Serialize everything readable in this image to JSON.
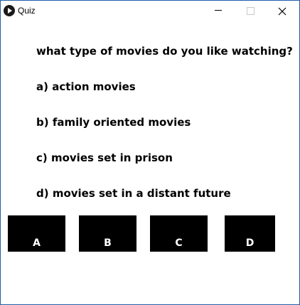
{
  "window": {
    "title": "Quiz",
    "app_icon": "play-circle-icon",
    "controls": {
      "minimize_icon": "minimize-icon",
      "maximize_icon": "maximize-icon",
      "close_icon": "close-icon"
    }
  },
  "quiz": {
    "question": "what type of movies do you like watching?",
    "options": [
      {
        "text": "a) action movies"
      },
      {
        "text": "b) family oriented movies"
      },
      {
        "text": "c) movies set in prison"
      },
      {
        "text": "d) movies set in a distant future"
      }
    ],
    "buttons": [
      {
        "label": "A"
      },
      {
        "label": "B"
      },
      {
        "label": "C"
      },
      {
        "label": "D"
      }
    ]
  },
  "colors": {
    "window_border": "#1f5fa8",
    "button_bg": "#000000",
    "button_text": "#ffffff",
    "text": "#000000"
  }
}
